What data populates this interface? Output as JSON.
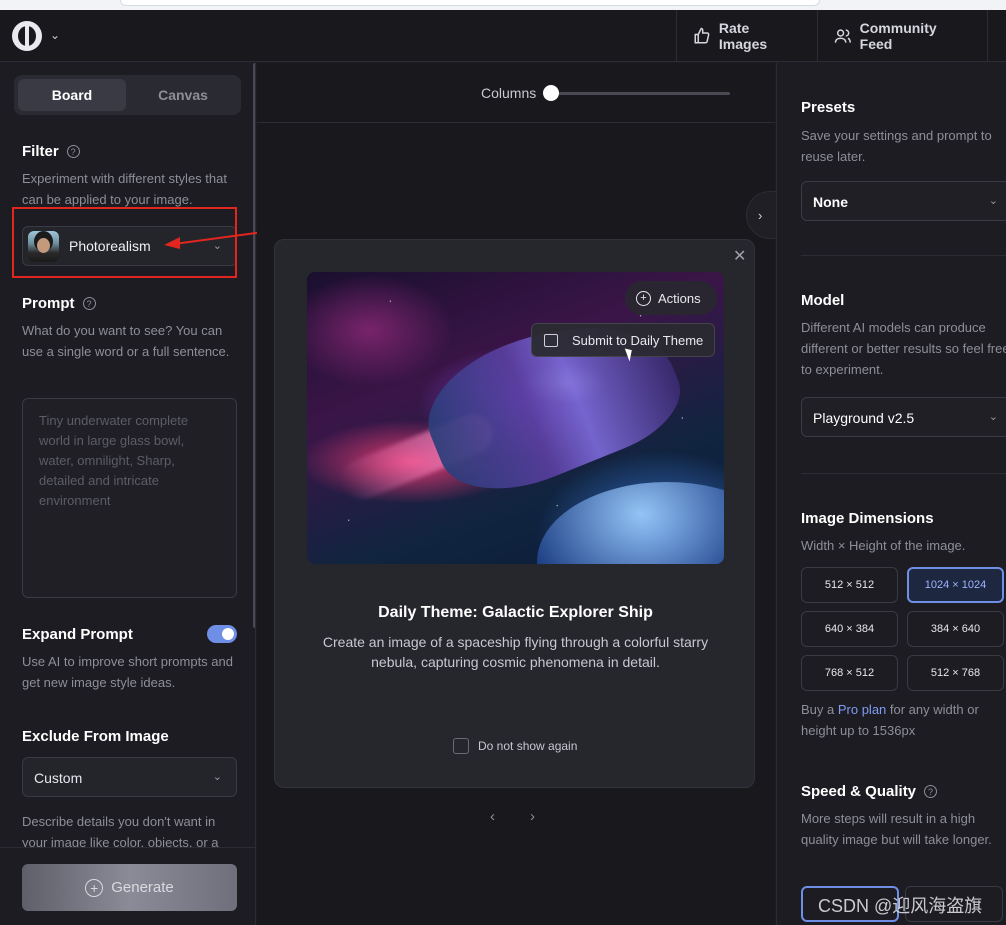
{
  "nav": {
    "rate_label": "Rate Images",
    "community_label": "Community Feed"
  },
  "sidebar": {
    "tabs": [
      "Board",
      "Canvas"
    ],
    "filter": {
      "title": "Filter",
      "desc": "Experiment with different styles that can be applied to your image.",
      "value": "Photorealism"
    },
    "prompt": {
      "title": "Prompt",
      "desc": "What do you want to see? You can use a single word or a full sentence.",
      "placeholder": "Tiny underwater complete world in large glass bowl, water, omnilight, Sharp, detailed and intricate environment"
    },
    "expand": {
      "title": "Expand Prompt",
      "desc": "Use AI to improve short prompts and get new image style ideas.",
      "enabled": true
    },
    "exclude": {
      "title": "Exclude From Image",
      "value": "Custom",
      "desc": "Describe details you don't want in your image like color, objects, or a"
    },
    "generate_label": "Generate"
  },
  "center": {
    "columns_label": "Columns",
    "columns_value": 0
  },
  "modal": {
    "actions_label": "Actions",
    "submit_label": "Submit to Daily Theme",
    "title": "Daily Theme: Galactic Explorer Ship",
    "desc": "Create an image of a spaceship flying through a colorful starry nebula, capturing cosmic phenomena in detail.",
    "dont_show_label": "Do not show again"
  },
  "right": {
    "presets": {
      "title": "Presets",
      "desc": "Save your settings and prompt to reuse later.",
      "value": "None"
    },
    "model": {
      "title": "Model",
      "desc": "Different AI models can produce different or better results so feel free to experiment.",
      "value": "Playground v2.5"
    },
    "dimensions": {
      "title": "Image Dimensions",
      "desc": "Width × Height of the image.",
      "options": [
        "512 × 512",
        "1024 × 1024",
        "640 × 384",
        "384 × 640",
        "768 × 512",
        "512 × 768"
      ],
      "selected": "1024 × 1024",
      "pro_prefix": "Buy a ",
      "pro_link": "Pro plan",
      "pro_suffix": " for any width or height up to 1536px"
    },
    "speed": {
      "title": "Speed & Quality",
      "desc": "More steps will result in a high quality image but will take longer."
    }
  },
  "watermark": "CSDN @迎风海盗旗",
  "colors": {
    "accent": "#6f8fe6",
    "annotation": "#e0261e"
  }
}
